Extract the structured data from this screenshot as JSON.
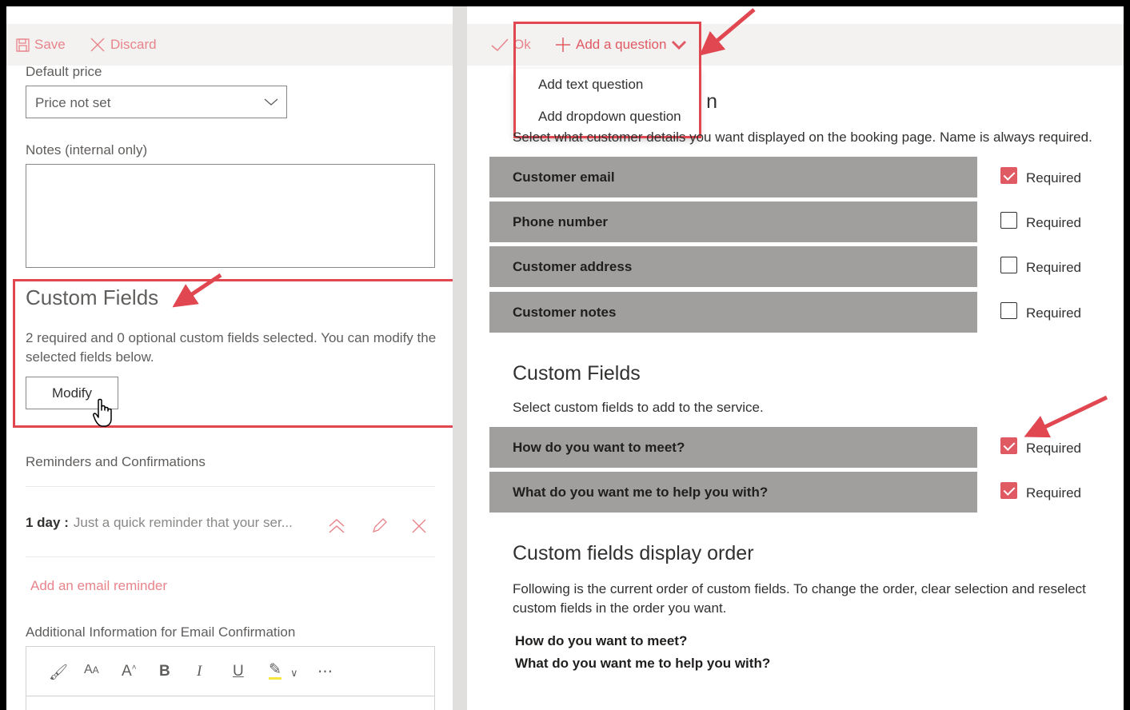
{
  "left_toolbar": {
    "save_label": "Save",
    "discard_label": "Discard"
  },
  "default_price": {
    "label": "Default price",
    "value": "Price not set"
  },
  "notes": {
    "label": "Notes (internal only)"
  },
  "custom_fields": {
    "title": "Custom Fields",
    "description": "2 required and 0 optional custom fields selected. You can modify the selected fields below.",
    "modify_label": "Modify"
  },
  "reminders": {
    "heading": "Reminders and Confirmations",
    "items": [
      {
        "when": "1 day :",
        "text": "Just a quick reminder that your ser..."
      }
    ],
    "add_link": "Add an email reminder"
  },
  "email_info": {
    "label": "Additional Information for Email Confirmation"
  },
  "right_toolbar": {
    "ok_label": "Ok",
    "add_question_label": "Add a question",
    "menu": [
      "Add text question",
      "Add dropdown question"
    ]
  },
  "customer_info": {
    "title_tail": "n",
    "description": "Select what customer details you want displayed on the booking page. Name is always required.",
    "fields": [
      {
        "name": "Customer email",
        "required": true,
        "required_label": "Required"
      },
      {
        "name": "Phone number",
        "required": false,
        "required_label": "Required"
      },
      {
        "name": "Customer address",
        "required": false,
        "required_label": "Required"
      },
      {
        "name": "Customer notes",
        "required": false,
        "required_label": "Required"
      }
    ]
  },
  "right_custom_fields": {
    "title": "Custom Fields",
    "description": "Select custom fields to add to the service.",
    "fields": [
      {
        "name": "How do you want to meet?",
        "required": true,
        "required_label": "Required"
      },
      {
        "name": "What do you want me to help you with?",
        "required": true,
        "required_label": "Required"
      }
    ]
  },
  "display_order": {
    "title": "Custom fields display order",
    "description": "Following is the current order of custom fields. To change the order, clear selection and reselect custom fields in the order you want.",
    "items": [
      "How do you want to meet?",
      "What do you want me to help you with?"
    ]
  },
  "colors": {
    "accent": "#e05a63",
    "annotation": "#e04750",
    "row_bg": "#a19f9d"
  }
}
